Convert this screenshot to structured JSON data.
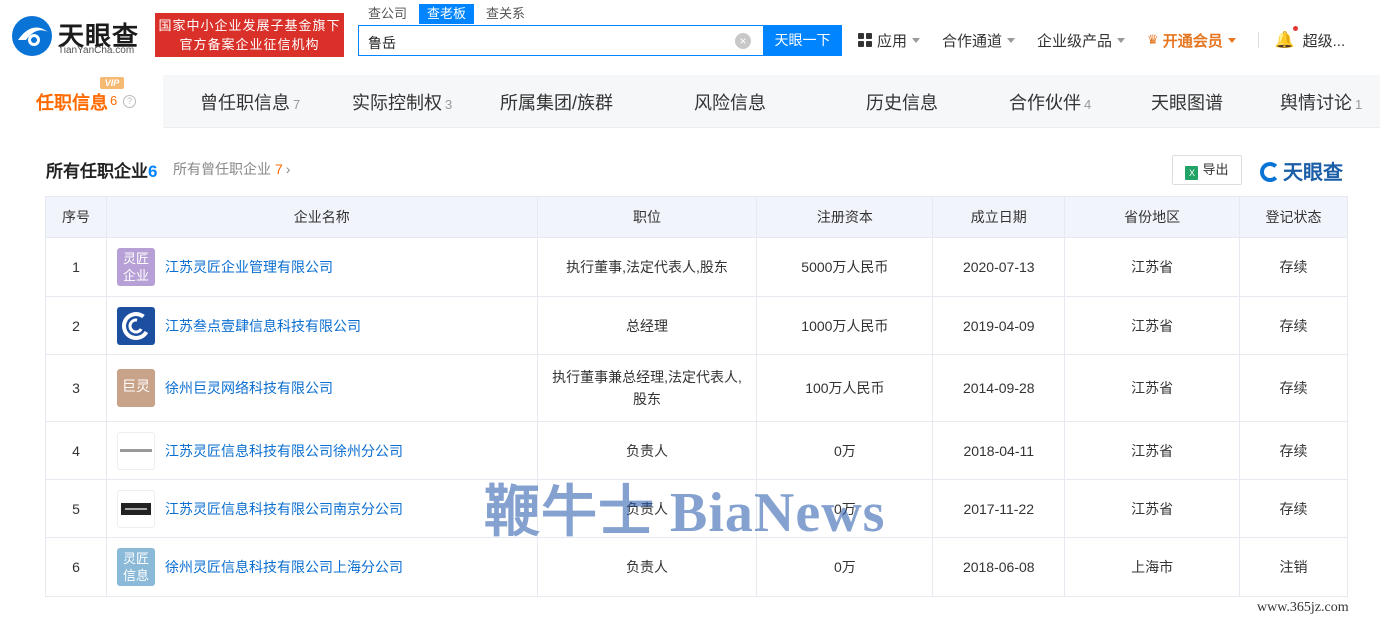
{
  "header": {
    "logo_text": "天眼查",
    "logo_url": "TianYanCha.com",
    "promo_line1": "国家中小企业发展子基金旗下",
    "promo_line2": "官方备案企业征信机构",
    "search_tabs": [
      "查公司",
      "查老板",
      "查关系"
    ],
    "search_value": "鲁岳",
    "search_button": "天眼一下",
    "nav": {
      "apps": "应用",
      "channel": "合作通道",
      "enterprise": "企业级产品",
      "vip": "开通会员",
      "user": "超级..."
    }
  },
  "tabs": {
    "active": {
      "label": "任职信息",
      "count": "6",
      "badge": "VIP"
    },
    "items": [
      {
        "label": "曾任职信息",
        "count": "7"
      },
      {
        "label": "实际控制权",
        "count": "3"
      },
      {
        "label": "所属集团/族群",
        "count": ""
      },
      {
        "label": "风险信息",
        "count": ""
      },
      {
        "label": "历史信息",
        "count": ""
      },
      {
        "label": "合作伙伴",
        "count": "4"
      },
      {
        "label": "天眼图谱",
        "count": ""
      },
      {
        "label": "舆情讨论",
        "count": "1"
      }
    ]
  },
  "section": {
    "title": "所有任职企业",
    "title_count": "6",
    "sub_label": "所有曾任职企业",
    "sub_count": "7",
    "export_label": "导出",
    "brand": "天眼查"
  },
  "table": {
    "headers": [
      "序号",
      "企业名称",
      "职位",
      "注册资本",
      "成立日期",
      "省份地区",
      "登记状态"
    ],
    "rows": [
      {
        "no": "1",
        "logo": "灵匠企业",
        "name": "江苏灵匠企业管理有限公司",
        "position": "执行董事,法定代表人,股东",
        "capital": "5000万人民币",
        "date": "2020-07-13",
        "region": "江苏省",
        "status": "存续"
      },
      {
        "no": "2",
        "logo": "",
        "name": "江苏叁点壹肆信息科技有限公司",
        "position": "总经理",
        "capital": "1000万人民币",
        "date": "2019-04-09",
        "region": "江苏省",
        "status": "存续"
      },
      {
        "no": "3",
        "logo": "巨灵",
        "name": "徐州巨灵网络科技有限公司",
        "position": "执行董事兼总经理,法定代表人,股东",
        "capital": "100万人民币",
        "date": "2014-09-28",
        "region": "江苏省",
        "status": "存续"
      },
      {
        "no": "4",
        "logo": "",
        "name": "江苏灵匠信息科技有限公司徐州分公司",
        "position": "负责人",
        "capital": "0万",
        "date": "2018-04-11",
        "region": "江苏省",
        "status": "存续"
      },
      {
        "no": "5",
        "logo": "",
        "name": "江苏灵匠信息科技有限公司南京分公司",
        "position": "负责人",
        "capital": "0万",
        "date": "2017-11-22",
        "region": "江苏省",
        "status": "存续"
      },
      {
        "no": "6",
        "logo": "灵匠信息",
        "name": "徐州灵匠信息科技有限公司上海分公司",
        "position": "负责人",
        "capital": "0万",
        "date": "2018-06-08",
        "region": "上海市",
        "status": "注销"
      }
    ]
  },
  "watermark": "鞭牛士 BiaNews",
  "site_url": "www.365jz.com",
  "colors": {
    "primary": "#0084ff",
    "orange": "#ff6a00",
    "status_ok": "#27a046",
    "status_off": "#e2463a",
    "promo": "#d9312a"
  }
}
